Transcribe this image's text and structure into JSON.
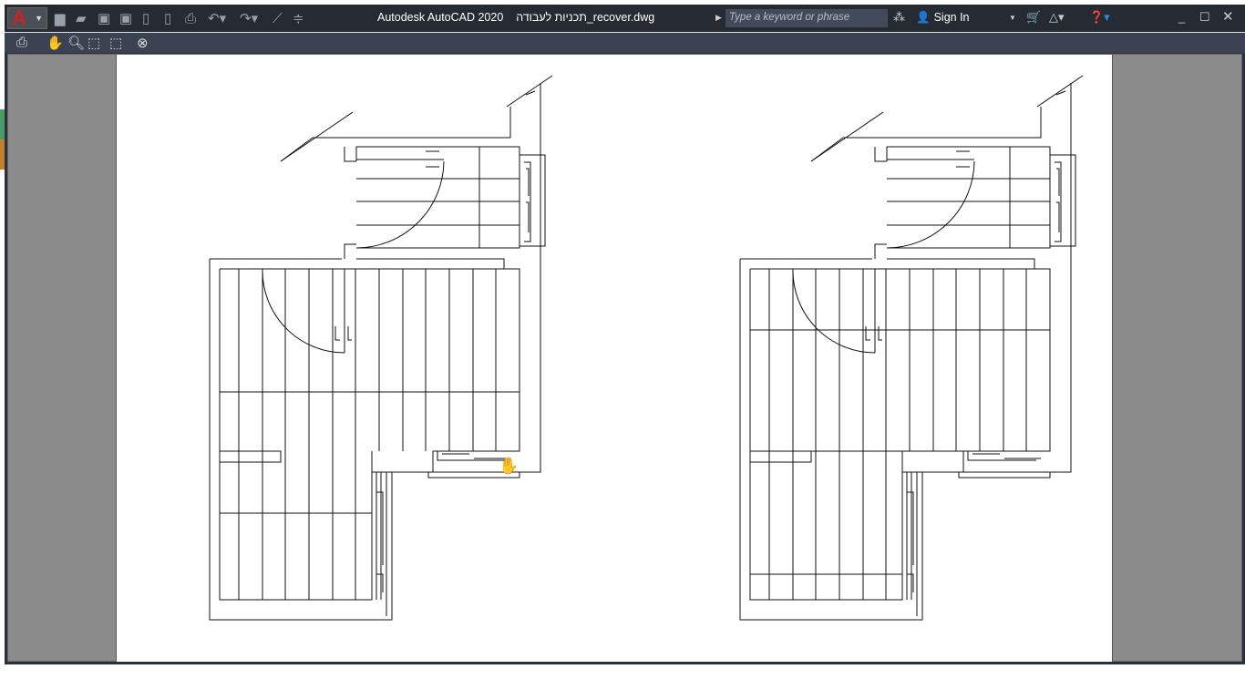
{
  "app": {
    "title": "Autodesk AutoCAD 2020",
    "file": "תכניות לעבודה_recover.dwg",
    "logo": "A"
  },
  "search": {
    "placeholder": "Type a keyword or phrase"
  },
  "account": {
    "sign_in": "Sign In"
  },
  "quick_access": [
    "new-icon",
    "open-icon",
    "save-icon",
    "save-as-icon",
    "open-web-icon",
    "save-web-icon",
    "plot-icon",
    "undo-icon",
    "redo-icon",
    "match-properties-icon",
    "customize-icon"
  ],
  "preview_toolbar": [
    "print-icon",
    "pan-icon",
    "zoom-icon",
    "zoom-window-icon",
    "zoom-original-icon",
    "close-preview-icon"
  ],
  "colors": {
    "titlebar": "#252a33",
    "toolbar": "#3b4252",
    "canvas": "#8b8b8b",
    "paper": "#ffffff"
  }
}
